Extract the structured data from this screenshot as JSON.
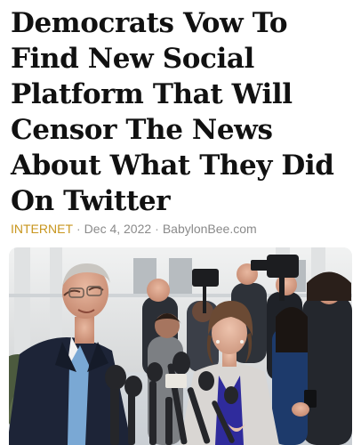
{
  "article": {
    "headline_lines": [
      "Democrats Vow To",
      "Find New Social",
      "Platform That Will",
      "Censor The News",
      "About What They Did",
      "On Twitter"
    ],
    "category": "INTERNET",
    "separator": "·",
    "date": "Dec 4, 2022",
    "source": "BabylonBee.com"
  },
  "colors": {
    "category": "#c8961e",
    "meta_text": "#8a8a8a",
    "headline_text": "#111111"
  }
}
